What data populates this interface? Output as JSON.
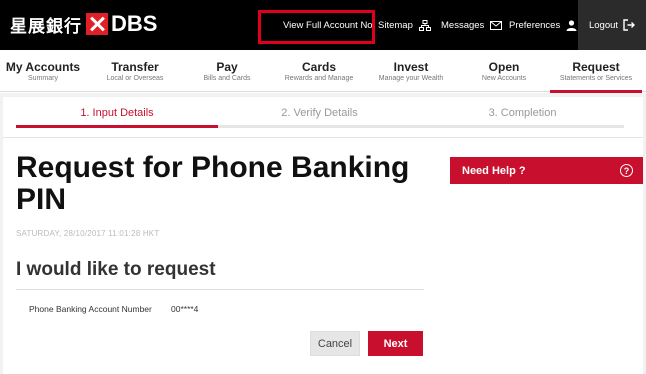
{
  "header": {
    "logo_cn": "星展銀行",
    "logo_brand": "DBS",
    "links": {
      "view_full_account": "View Full Account No.",
      "sitemap": "Sitemap",
      "messages": "Messages",
      "preferences": "Preferences",
      "logout": "Logout"
    },
    "icons": {
      "sitemap": "sitemap-icon",
      "messages": "envelope-icon",
      "preferences": "user-icon",
      "logout": "logout-icon"
    }
  },
  "nav": {
    "items": [
      {
        "label": "My Accounts",
        "sub": "Summary"
      },
      {
        "label": "Transfer",
        "sub": "Local or Overseas"
      },
      {
        "label": "Pay",
        "sub": "Bills and Cards"
      },
      {
        "label": "Cards",
        "sub": "Rewards and Manage"
      },
      {
        "label": "Invest",
        "sub": "Manage your Wealth"
      },
      {
        "label": "Open",
        "sub": "New Accounts"
      },
      {
        "label": "Request",
        "sub": "Statements or Services"
      }
    ],
    "active_index": 6
  },
  "steps": [
    {
      "label": "1. Input Details",
      "active": true
    },
    {
      "label": "2. Verify Details",
      "active": false
    },
    {
      "label": "3. Completion",
      "active": false
    }
  ],
  "main": {
    "title": "Request for Phone Banking PIN",
    "timestamp": "SATURDAY, 28/10/2017 11:01:28 HKT",
    "subtitle": "I would like to request",
    "field_label": "Phone Banking Account Number",
    "field_value": "00****4",
    "cancel_label": "Cancel",
    "next_label": "Next"
  },
  "help": {
    "label": "Need Help ?",
    "icon": "question-circle-icon"
  },
  "colors": {
    "brand_red": "#c8102e",
    "highlight_box": "#e0001b",
    "topbar": "#000000"
  }
}
